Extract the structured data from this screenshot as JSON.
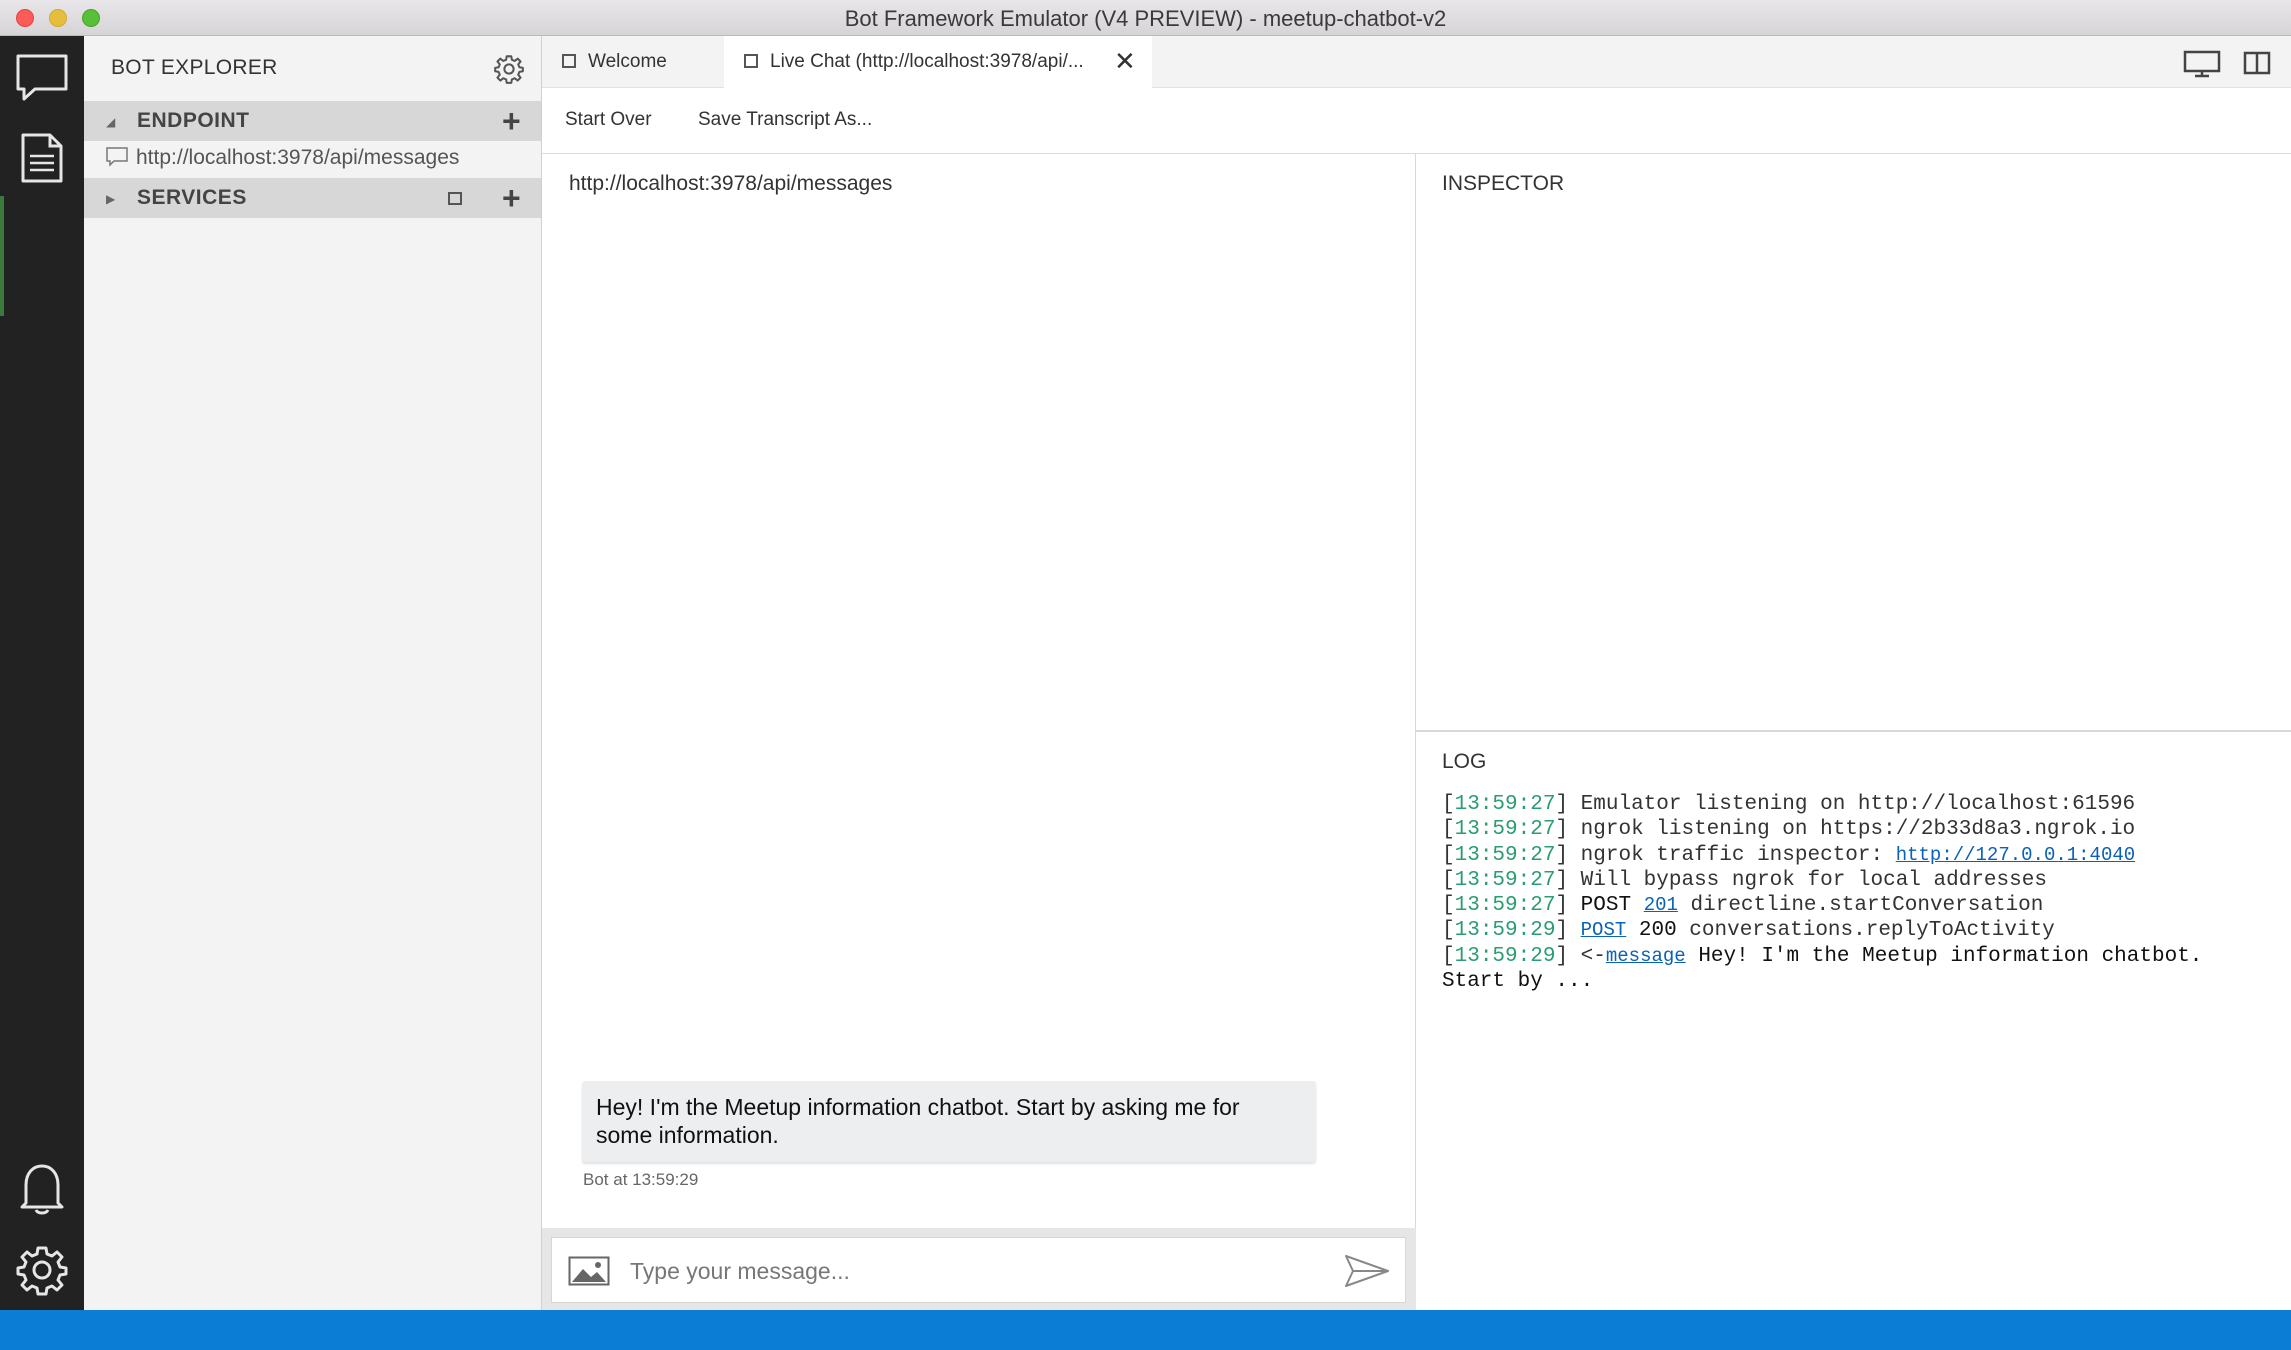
{
  "window": {
    "title": "Bot Framework Emulator (V4 PREVIEW) - meetup-chatbot-v2"
  },
  "sidebar": {
    "title": "BOT EXPLORER",
    "endpoint_section": "ENDPOINT",
    "endpoint_url": "http://localhost:3978/api/messages",
    "services_section": "SERVICES"
  },
  "tabs": [
    {
      "label": "Welcome"
    },
    {
      "label": "Live Chat (http://localhost:3978/api/..."
    }
  ],
  "toolbar": {
    "start_over": "Start Over",
    "save_transcript": "Save Transcript As..."
  },
  "chat": {
    "endpoint_url": "http://localhost:3978/api/messages",
    "message_text": "Hey! I'm the Meetup information chatbot. Start by asking me for some information.",
    "message_meta": "Bot at 13:59:29",
    "input_placeholder": "Type your message..."
  },
  "inspector": {
    "title": "INSPECTOR"
  },
  "log": {
    "title": "LOG",
    "lines": [
      {
        "time": "13:59:27",
        "text": "Emulator listening on http://localhost:61596"
      },
      {
        "time": "13:59:27",
        "text": "ngrok listening on https://2b33d8a3.ngrok.io"
      },
      {
        "time": "13:59:27",
        "text": "ngrok traffic inspector:",
        "link": "http://127.0.0.1:4040"
      },
      {
        "time": "13:59:27",
        "text": "Will bypass ngrok for local addresses"
      },
      {
        "time": "13:59:27",
        "method": "POST",
        "status": "201",
        "text": "directline.startConversation"
      },
      {
        "time": "13:59:29",
        "method": "POST",
        "status": "200",
        "text": "conversations.replyToActivity"
      },
      {
        "time": "13:59:29",
        "arrow": "<-",
        "link": "message",
        "text": "Hey! I'm the Meetup information chatbot.",
        "continuation": "Start by ..."
      }
    ]
  },
  "colors": {
    "accent": "#0b7dd4",
    "timestamp": "#2a9d6f",
    "link": "#0a61b8",
    "activity_bar": "#222222"
  },
  "icons": [
    "chat-icon",
    "transcript-icon",
    "bell-icon",
    "settings-icon",
    "gear-icon",
    "image-icon",
    "send-icon",
    "monitor-icon",
    "split-view-icon"
  ]
}
